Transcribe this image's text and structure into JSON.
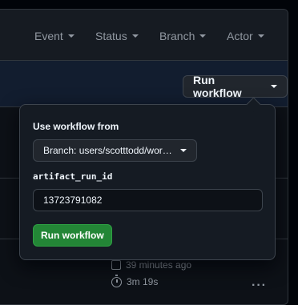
{
  "filters": {
    "event": "Event",
    "status": "Status",
    "branch": "Branch",
    "actor": "Actor"
  },
  "banner": {
    "run_workflow_label": "Run workflow"
  },
  "background_run": {
    "time_ago": "39 minutes ago",
    "duration": "3m 19s",
    "more_icon": "kebab-horizontal-icon"
  },
  "dropdown": {
    "heading": "Use workflow from",
    "branch_select": "Branch: users/scotttodd/wor…",
    "input_label": "artifact_run_id",
    "input_value": "13723791082",
    "submit_label": "Run workflow"
  },
  "colors": {
    "primary_button": "#238636",
    "banner_bg": "#121d2f",
    "panel_bg": "#0d1117",
    "overlay_bg": "#151b23"
  }
}
